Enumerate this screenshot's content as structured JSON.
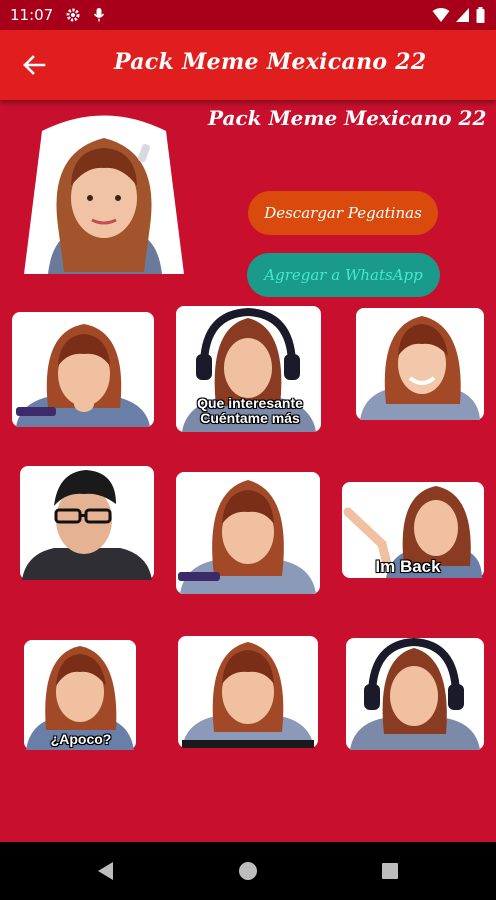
{
  "status_bar": {
    "time": "11:07",
    "left_icons": [
      "gear-icon",
      "mic-icon"
    ],
    "right_icons": [
      "wifi-icon",
      "signal-icon",
      "battery-icon"
    ]
  },
  "app_bar": {
    "title": "Pack Meme Mexicano 22",
    "back_icon": "arrow-left-icon"
  },
  "pack": {
    "title": "Pack Meme Mexicano 22",
    "download_label": "Descargar Pegatinas",
    "whatsapp_label": "Agregar a WhatsApp"
  },
  "stickers": [
    {
      "caption": ""
    },
    {
      "caption": "Que interesante\nCuéntame más"
    },
    {
      "caption": ""
    },
    {
      "caption": ""
    },
    {
      "caption": ""
    },
    {
      "caption": "Im Back"
    },
    {
      "caption": "¿Apoco?"
    },
    {
      "caption": ""
    },
    {
      "caption": ""
    }
  ],
  "nav_bar": {
    "buttons": [
      "back-triangle-icon",
      "home-circle-icon",
      "recents-square-icon"
    ]
  },
  "colors": {
    "background": "#c8102e",
    "app_bar": "#e01e1e",
    "status_bar": "#a8001a",
    "download_button": "#d94a0c",
    "whatsapp_button": "#1a9a8a",
    "whatsapp_text": "#44e8cf"
  }
}
